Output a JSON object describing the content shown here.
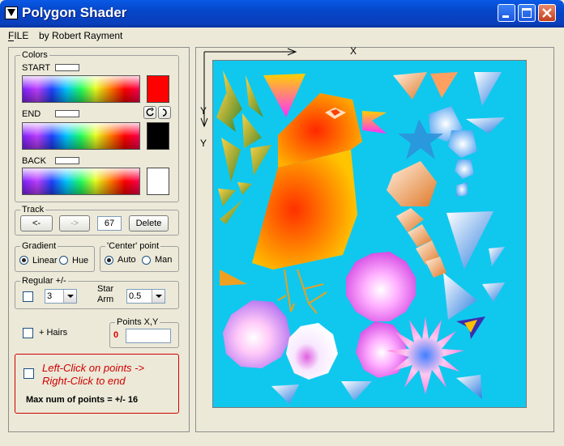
{
  "window": {
    "title": "Polygon Shader"
  },
  "menu": {
    "file": "FILE",
    "credit": "by Robert Rayment"
  },
  "colors": {
    "group_title": "Colors",
    "start_label": "START",
    "end_label": "END",
    "back_label": "BACK",
    "start_color": "#ff0000",
    "end_color": "#000000",
    "back_color": "#ffffff"
  },
  "track": {
    "group_title": "Track",
    "back_label": "<-",
    "forward_label": "->",
    "value": "67",
    "delete_label": "Delete"
  },
  "gradient": {
    "group_title": "Gradient",
    "linear_label": "Linear",
    "hue_label": "Hue",
    "selected": "Linear"
  },
  "center_point": {
    "group_title": "'Center' point",
    "auto_label": "Auto",
    "man_label": "Man",
    "selected": "Auto"
  },
  "regular": {
    "group_title": "Regular +/-",
    "sides_value": "3",
    "star_label": "Star",
    "arm_label": "Arm",
    "arm_value": "0.5"
  },
  "hairs": {
    "label": "+ Hairs"
  },
  "points": {
    "group_title": "Points X,Y",
    "count": "0",
    "value": ""
  },
  "instructions": {
    "line1": "Left-Click on points  ->",
    "line2": "Right-Click to end",
    "max_points": "Max num of points = +/- 16"
  },
  "axes": {
    "x_label": "X",
    "y_label": "Y"
  }
}
